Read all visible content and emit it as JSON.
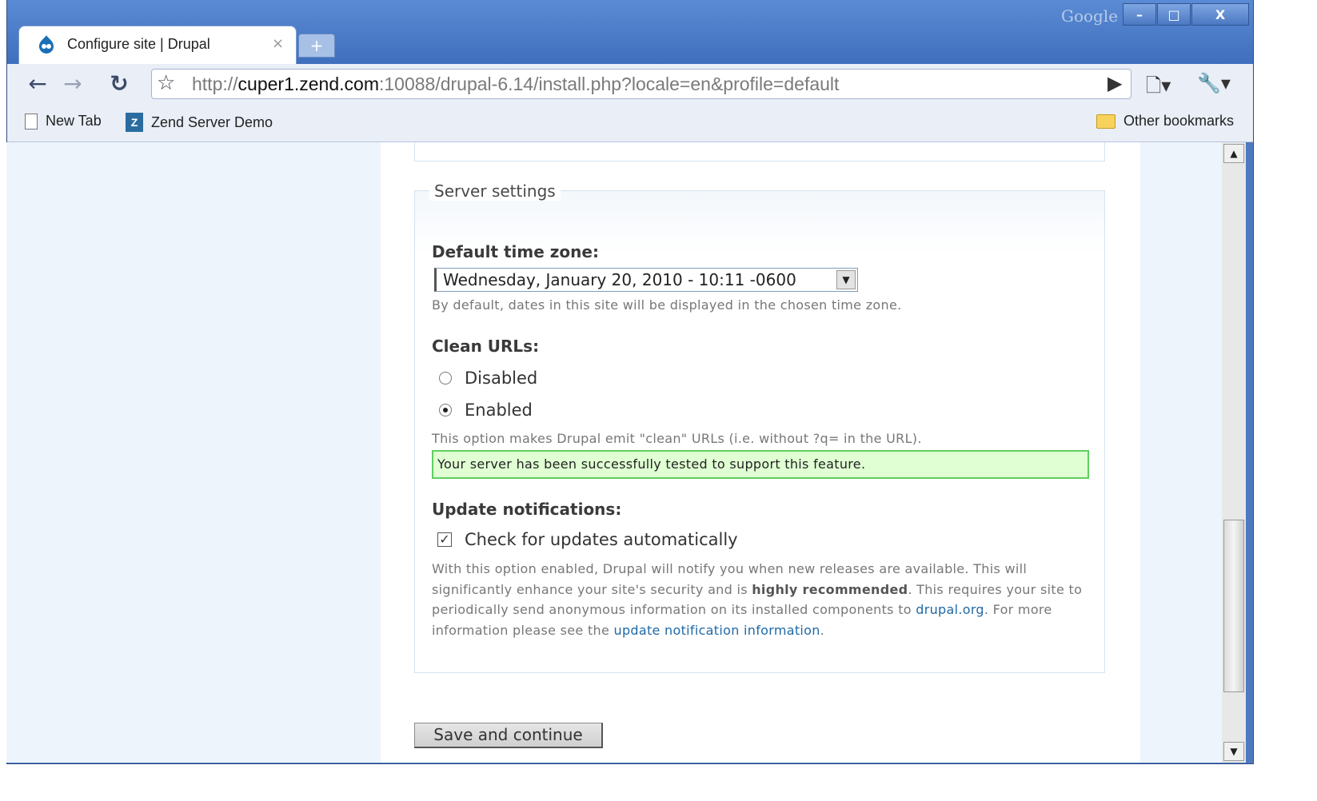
{
  "browser": {
    "brand": "Google",
    "tab_title": "Configure site | Drupal",
    "tab_close": "×",
    "new_tab_symbol": "+",
    "url_prefix": "http://",
    "url_host": "cuper1.zend.com",
    "url_rest": ":10088/drupal-6.14/install.php?locale=en&profile=default",
    "window_buttons": {
      "minimize": "–",
      "maximize": "□",
      "close": "X"
    }
  },
  "bookmarks": {
    "items": [
      "New Tab",
      "Zend Server Demo"
    ],
    "other": "Other bookmarks"
  },
  "page": {
    "fieldset_legend": "Server settings",
    "timezone": {
      "label": "Default time zone:",
      "selected": "Wednesday, January 20, 2010 - 10:11 -0600",
      "description": "By default, dates in this site will be displayed in the chosen time zone."
    },
    "clean_urls": {
      "label": "Clean URLs:",
      "options": [
        "Disabled",
        "Enabled"
      ],
      "selected": "Enabled",
      "description": "This option makes Drupal emit \"clean\" URLs (i.e. without ?q= in the URL).",
      "success": "Your server has been successfully tested to support this feature."
    },
    "updates": {
      "label": "Update notifications:",
      "checkbox_label": "Check for updates automatically",
      "checked": true,
      "desc_1": "With this option enabled, Drupal will notify you when new releases are available. This will significantly enhance your site's security and is ",
      "desc_bold": "highly recommended",
      "desc_2": ". This requires your site to periodically send anonymous information on its installed components to ",
      "link_drupal": "drupal.org",
      "desc_3": ". For more information please see the ",
      "link_info": "update notification information",
      "desc_4": "."
    },
    "save_button": "Save and continue"
  }
}
